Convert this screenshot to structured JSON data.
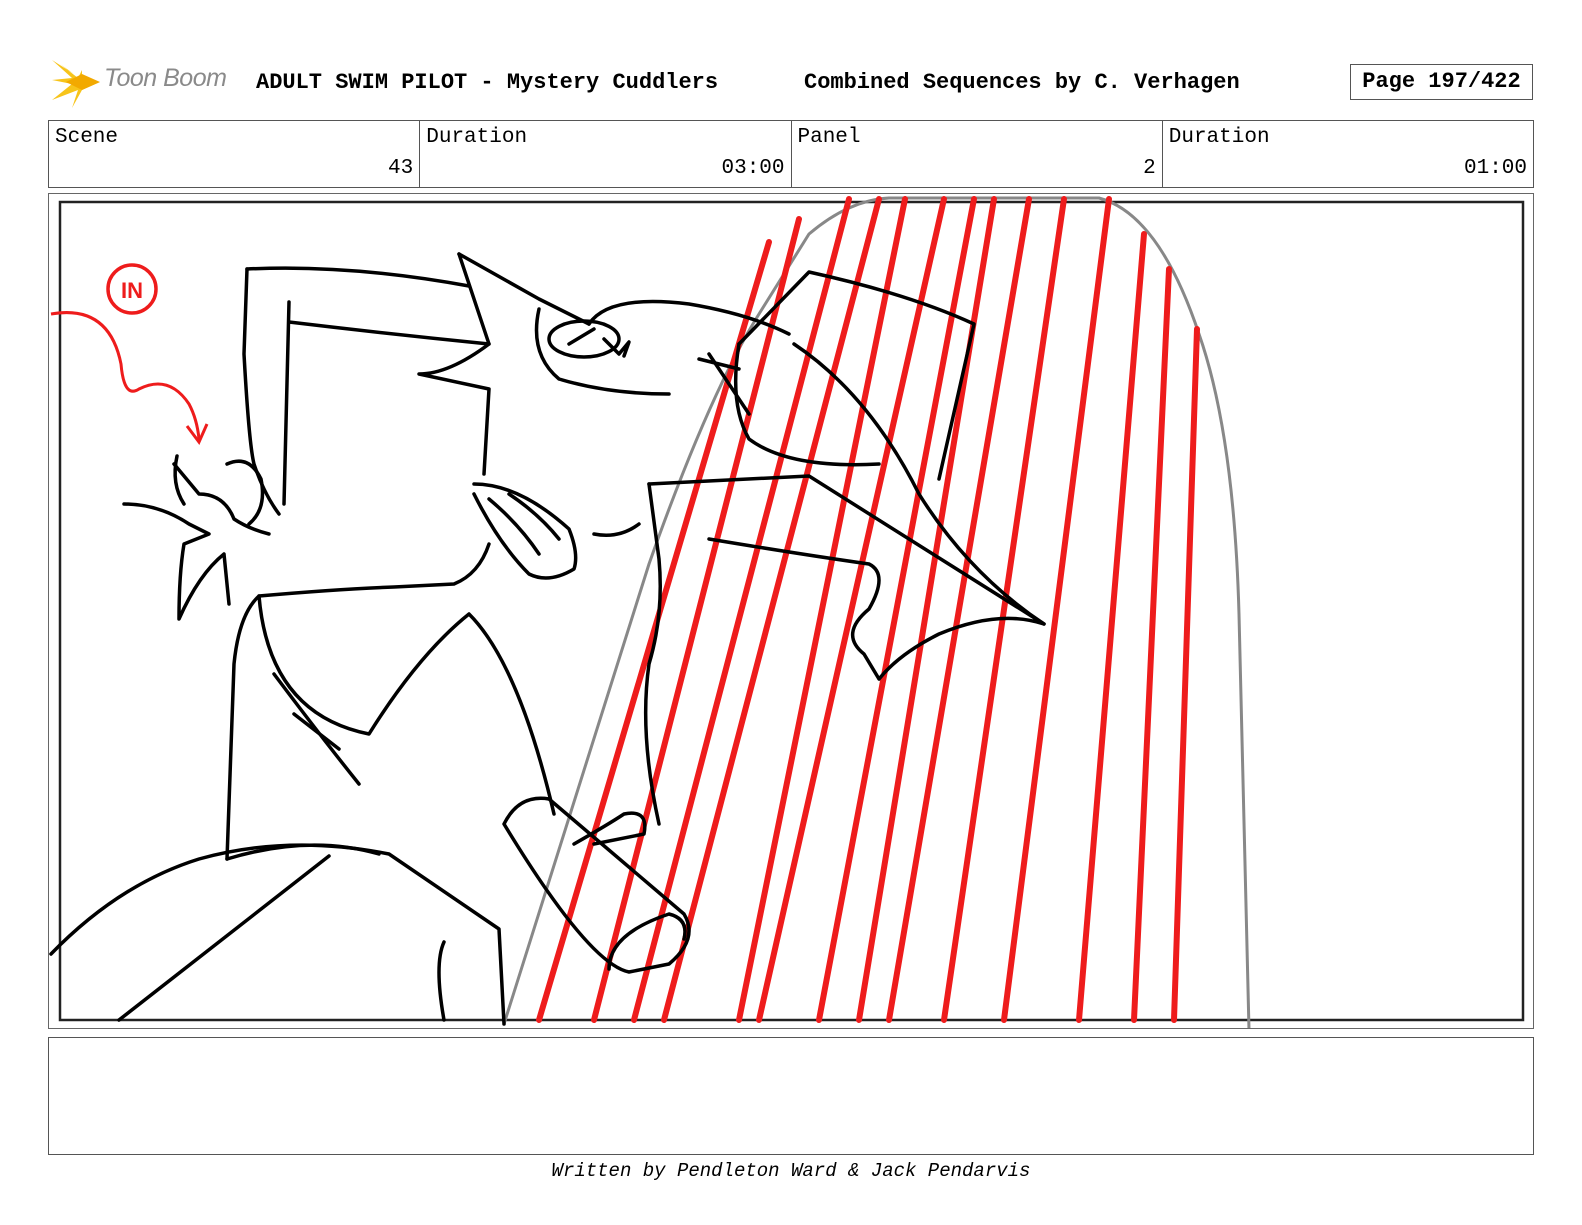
{
  "header": {
    "logo_text": "Toon Boom",
    "title": "ADULT SWIM PILOT - Mystery Cuddlers",
    "subtitle": "Combined Sequences by C. Verhagen",
    "page": "Page 197/422"
  },
  "info": [
    {
      "label": "Scene",
      "value": "43"
    },
    {
      "label": "Duration",
      "value": "03:00"
    },
    {
      "label": "Panel",
      "value": "2"
    },
    {
      "label": "Duration",
      "value": "01:00"
    }
  ],
  "panel": {
    "annotation": "IN",
    "accent_color": "#ee1c1c"
  },
  "notes": "",
  "footer": "Written by Pendleton Ward & Jack Pendarvis"
}
